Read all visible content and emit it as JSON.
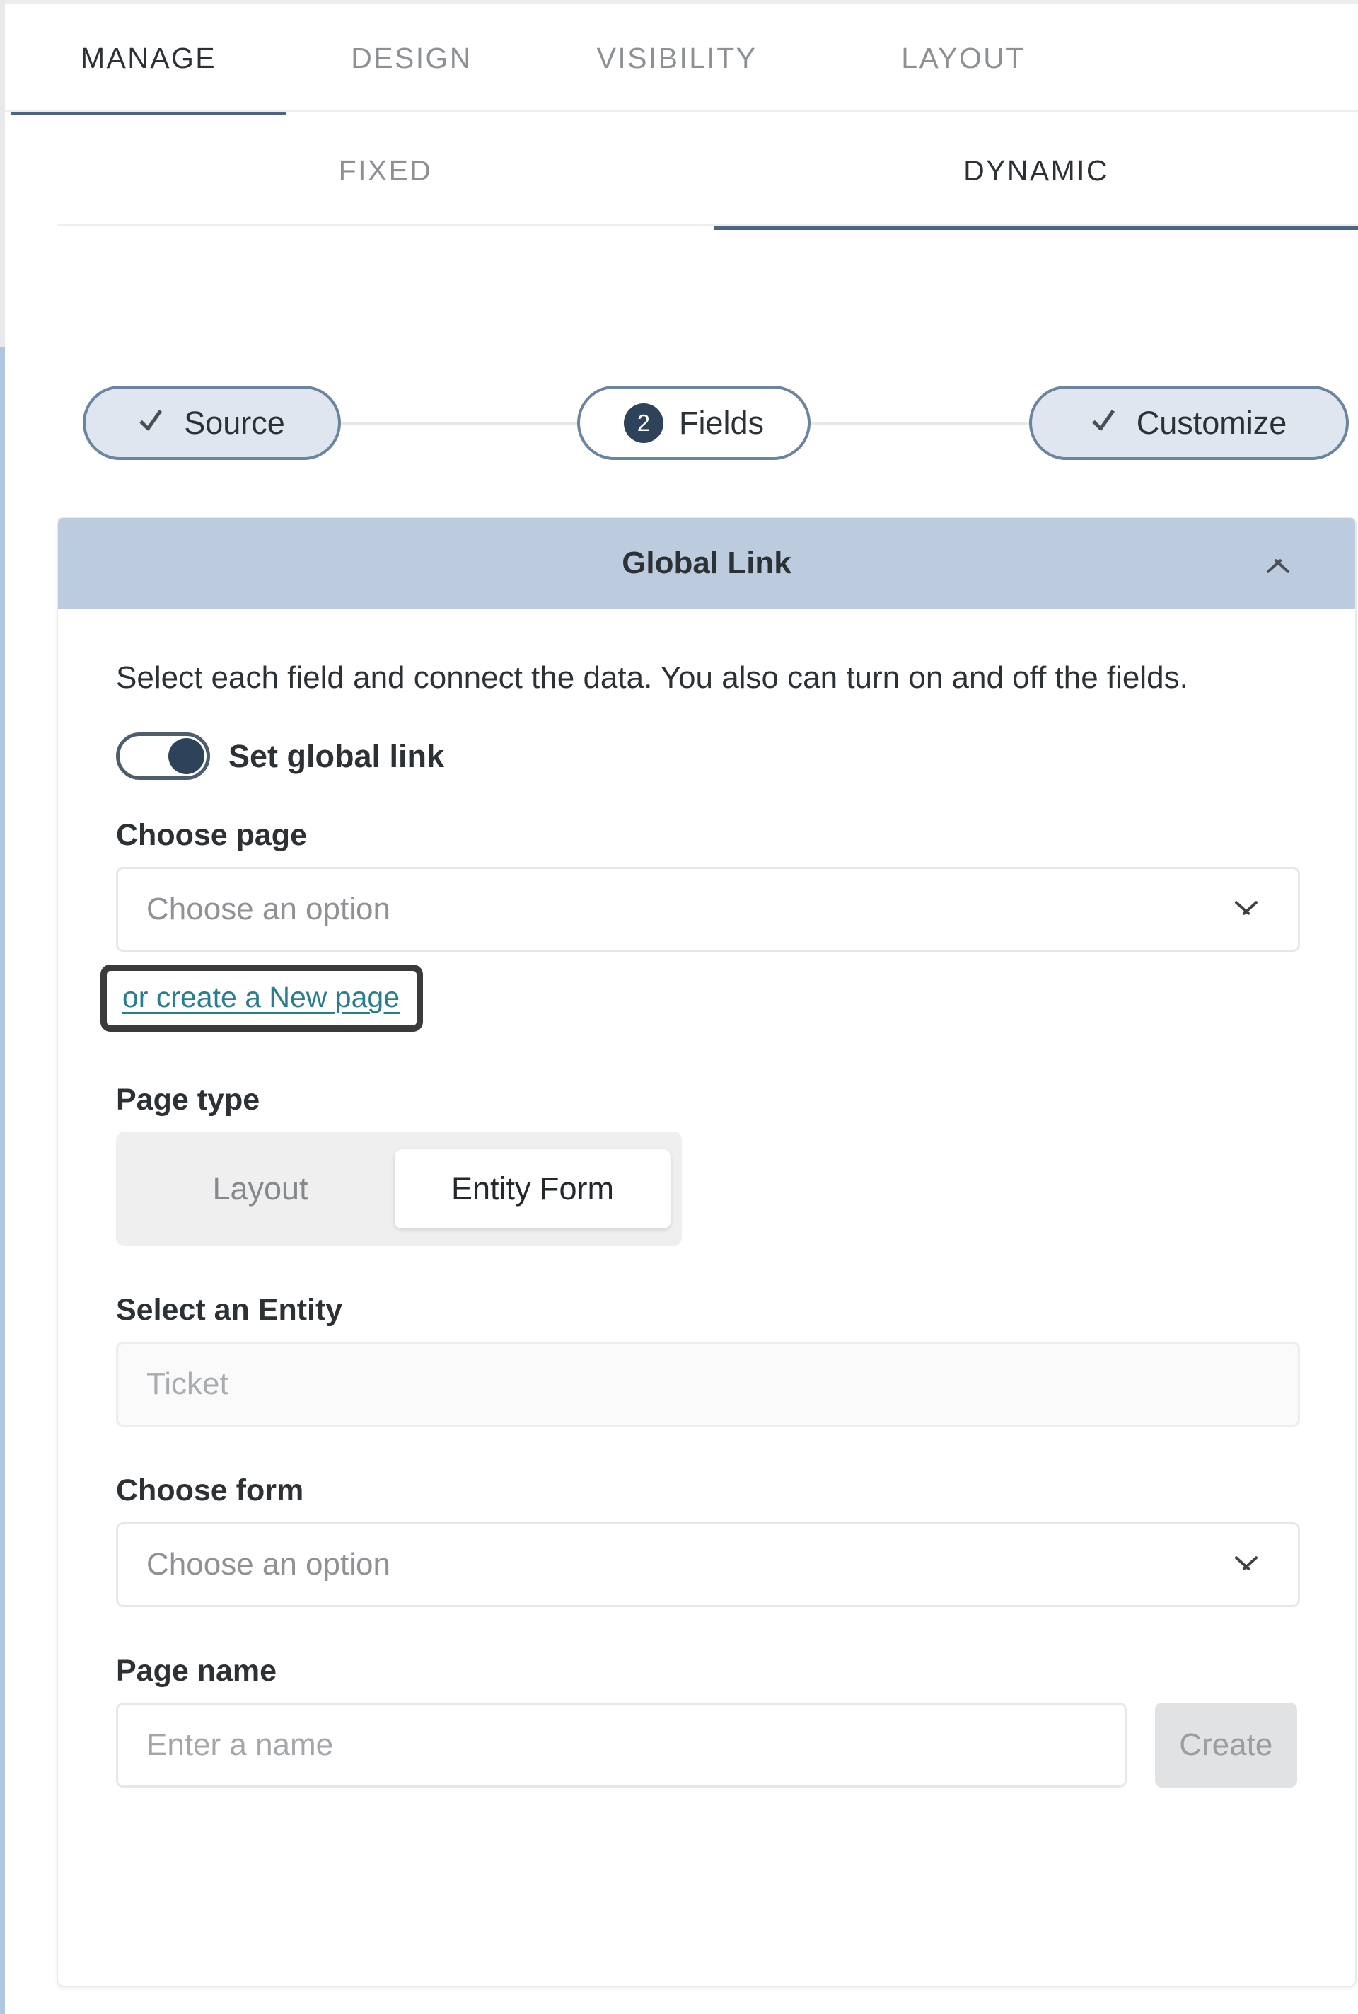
{
  "primary_tabs": [
    {
      "label": "MANAGE",
      "active": true
    },
    {
      "label": "DESIGN",
      "active": false
    },
    {
      "label": "VISIBILITY",
      "active": false
    },
    {
      "label": "LAYOUT",
      "active": false
    }
  ],
  "secondary_tabs": [
    {
      "label": "FIXED",
      "active": false
    },
    {
      "label": "DYNAMIC",
      "active": true
    }
  ],
  "stepper": {
    "steps": [
      {
        "label": "Source",
        "state": "complete",
        "icon": "check-icon"
      },
      {
        "label": "Fields",
        "state": "current",
        "number": "2"
      },
      {
        "label": "Customize",
        "state": "complete",
        "icon": "check-icon"
      }
    ]
  },
  "card": {
    "title": "Global Link",
    "collapse_icon": "chevron-up-icon",
    "description": "Select each field and connect the data. You also can turn on and off the fields.",
    "toggle": {
      "label": "Set global link",
      "state": "on"
    },
    "choose_page": {
      "label": "Choose page",
      "value": "Choose an option",
      "chevron_icon": "chevron-down-icon"
    },
    "new_page_link": "or create a New page",
    "page_type": {
      "label": "Page type",
      "options": [
        "Layout",
        "Entity Form"
      ],
      "selected": "Entity Form"
    },
    "select_entity": {
      "label": "Select an Entity",
      "placeholder": "Ticket",
      "value": ""
    },
    "choose_form": {
      "label": "Choose form",
      "value": "Choose an option",
      "chevron_icon": "chevron-down-icon"
    },
    "page_name": {
      "label": "Page name",
      "placeholder": "Enter a name",
      "value": "",
      "create_label": "Create"
    }
  },
  "colors": {
    "accent": "#4d6580",
    "card_header": "#bccbdd",
    "step_badge": "#2e4259",
    "link": "#2a7d8c",
    "highlight_box": "#3b3b3b"
  }
}
